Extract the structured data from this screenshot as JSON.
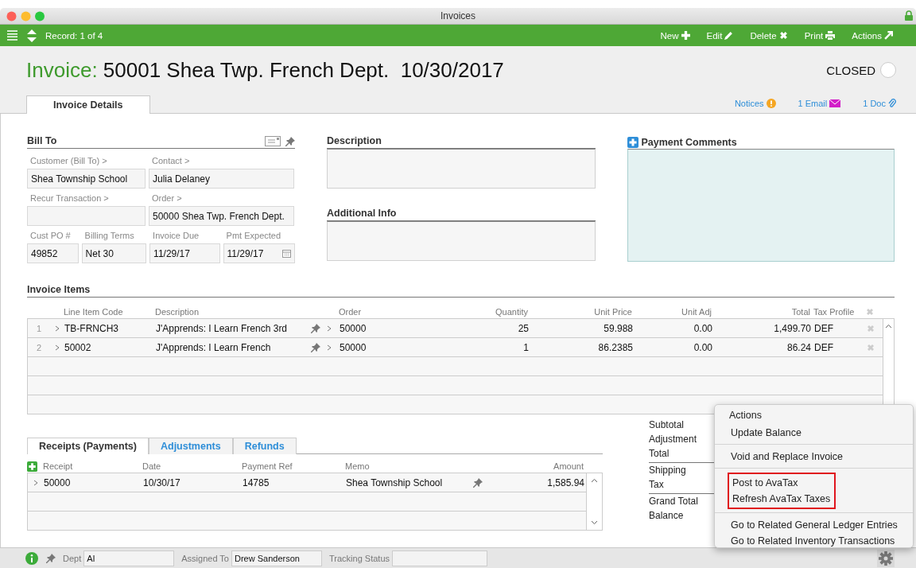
{
  "window": {
    "title": "Invoices"
  },
  "toolbar": {
    "record": "Record: 1 of 4",
    "actions": [
      {
        "label": "New",
        "kind": "new"
      },
      {
        "label": "Edit",
        "kind": "edit"
      },
      {
        "label": "Delete",
        "kind": "delete"
      },
      {
        "label": "Print",
        "kind": "print"
      },
      {
        "label": "Actions",
        "kind": "actions"
      }
    ]
  },
  "header": {
    "label": "Invoice:",
    "title": "50001 Shea Twp. French Dept.",
    "date": "10/30/2017",
    "status": "CLOSED"
  },
  "tabs": [
    {
      "label": "Invoice Details",
      "selected": true
    }
  ],
  "links": [
    {
      "label": "Notices",
      "kind": "notice"
    },
    {
      "label": "1 Email",
      "kind": "email"
    },
    {
      "label": "1 Doc",
      "kind": "doc"
    }
  ],
  "bill_to": {
    "title": "Bill To",
    "rows": [
      [
        {
          "label": "Customer (Bill To) >",
          "value": "Shea Township School"
        },
        {
          "label": "Contact >",
          "value": "Julia Delaney"
        }
      ],
      [
        {
          "label": "Recur Transaction >"
        },
        {
          "label": "Order >",
          "value": "50000 Shea Twp. French Dept."
        }
      ],
      [
        {
          "label": "Cust PO #",
          "value": "49852"
        },
        {
          "label": "Billing Terms",
          "value": "Net 30"
        },
        {
          "label": "Invoice Due",
          "value": "11/29/17"
        },
        {
          "label": "Pmt Expected",
          "value": "11/29/17",
          "kind": "date"
        }
      ]
    ]
  },
  "description": {
    "title": "Description"
  },
  "additional_info": {
    "title": "Additional Info"
  },
  "payment_comments": {
    "title": "Payment Comments"
  },
  "invoice_items": {
    "title": "Invoice Items",
    "columns": [
      "Line Item Code",
      "Description",
      "Order",
      "Quantity",
      "Unit Price",
      "Unit Adj",
      "Total",
      "Tax Profile"
    ],
    "rows": [
      {
        "number": "1",
        "cells": [
          "TB-FRNCH3",
          "J'Apprends: I Learn French 3rd",
          "50000",
          "25",
          "59.988",
          "0.00",
          "1,499.70",
          "DEF"
        ]
      },
      {
        "number": "2",
        "cells": [
          "50002",
          "J'Apprends: I Learn French",
          "50000",
          "1",
          "86.2385",
          "0.00",
          "86.24",
          "DEF"
        ]
      }
    ]
  },
  "receipts": {
    "tabs": [
      {
        "label": "Receipts (Payments)",
        "selected": true
      },
      {
        "label": "Adjustments",
        "selected": false
      },
      {
        "label": "Refunds",
        "selected": false
      }
    ],
    "columns": [
      "Receipt",
      "Date",
      "Payment Ref",
      "Memo",
      "Amount"
    ],
    "rows": [
      {
        "cells": [
          "50000",
          "10/30/17",
          "14785",
          "Shea Township School",
          "1,585.94"
        ]
      }
    ]
  },
  "totals": [
    [
      "Subtotal",
      "Adjustment",
      "Total"
    ],
    [
      "Shipping",
      "Tax"
    ],
    [
      "Grand Total",
      "Balance"
    ]
  ],
  "actions_menu": {
    "title": "Actions",
    "groups": [
      {
        "highlighted": false,
        "items": [
          "Update Balance"
        ]
      },
      {
        "highlighted": false,
        "items": [
          "Void and Replace Invoice"
        ]
      },
      {
        "highlighted": true,
        "items": [
          "Post to AvaTax",
          "Refresh AvaTax Taxes"
        ]
      },
      {
        "highlighted": false,
        "items": [
          "Go to Related General Ledger Entries",
          "Go to Related Inventory Transactions"
        ]
      }
    ]
  },
  "footer": {
    "fields": [
      {
        "label": "Dept",
        "value": "AI"
      },
      {
        "label": "Assigned To",
        "value": "Drew Sanderson"
      },
      {
        "label": "Tracking Status"
      }
    ]
  }
}
